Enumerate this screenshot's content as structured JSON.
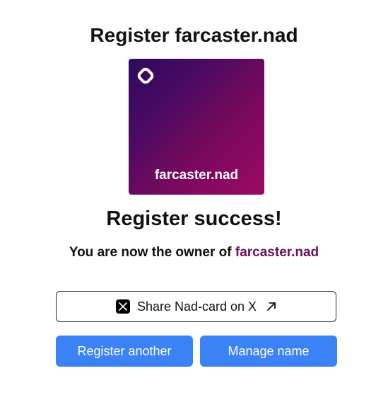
{
  "page": {
    "title": "Register farcaster.nad"
  },
  "card": {
    "name": "farcaster.nad",
    "logo_icon": "nad-logo-icon",
    "gradient_colors": [
      "#2e0a5e",
      "#6a0a5e",
      "#9a0a60"
    ]
  },
  "result": {
    "heading": "Register success!",
    "owner_prefix": "You are now the owner of ",
    "owner_name": "farcaster.nad",
    "owner_name_color": "#6b0f5c"
  },
  "actions": {
    "share_label": "Share Nad-card on X",
    "share_icon": "x-logo-icon",
    "share_external_icon": "arrow-up-right-icon",
    "register_another_label": "Register another",
    "manage_name_label": "Manage name",
    "primary_color": "#3b82f6"
  }
}
